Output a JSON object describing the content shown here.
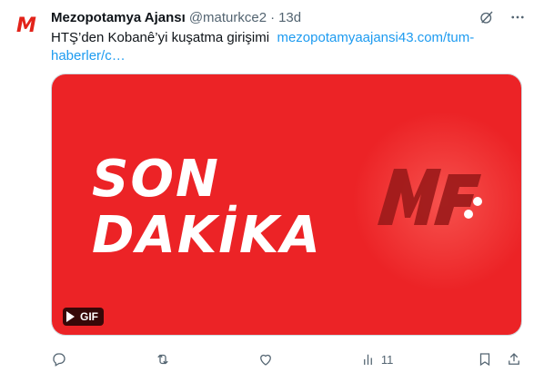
{
  "author": {
    "name": "Mezopotamya Ajansı",
    "handle": "@maturkce2",
    "time": "13d",
    "avatar_text": "M"
  },
  "tweet": {
    "text": "HTŞ’den Kobanê’yi kuşatma girişimi",
    "link_text": "mezopotamyaajansi43.com/tum-haberler/c…"
  },
  "media": {
    "headline_line1": "SON",
    "headline_line2": "DAKİKA",
    "logo_text": "M",
    "badge": "GIF",
    "background_color": "#ec2326"
  },
  "actions": {
    "reply_count": "",
    "retweet_count": "",
    "like_count": "",
    "views_count": "11"
  },
  "icons": [
    "grok-icon",
    "more-icon",
    "reply-icon",
    "retweet-icon",
    "like-icon",
    "views-icon",
    "bookmark-icon",
    "share-icon"
  ]
}
